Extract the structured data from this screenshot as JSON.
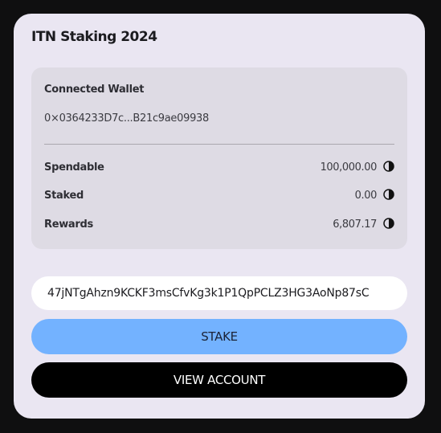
{
  "card": {
    "title": "ITN Staking 2024"
  },
  "wallet": {
    "label": "Connected Wallet",
    "address": "0×0364233D7c...B21c9ae09938"
  },
  "balances": [
    {
      "label": "Spendable",
      "value": "100,000.00",
      "icon": "token-icon"
    },
    {
      "label": "Staked",
      "value": "0.00",
      "icon": "token-icon"
    },
    {
      "label": "Rewards",
      "value": "6,807.17",
      "icon": "token-icon"
    }
  ],
  "stake_form": {
    "address_value": "47jNTgAhzn9KCKF3msCfvKg3k1P1QpPCLZ3HG3AoNp87sC",
    "stake_label": "STAKE",
    "view_account_label": "VIEW ACCOUNT"
  },
  "colors": {
    "card_bg": "#eae6f2",
    "panel_bg": "#dedbe4",
    "stake_button": "#73b2ff",
    "view_button": "#000000"
  }
}
